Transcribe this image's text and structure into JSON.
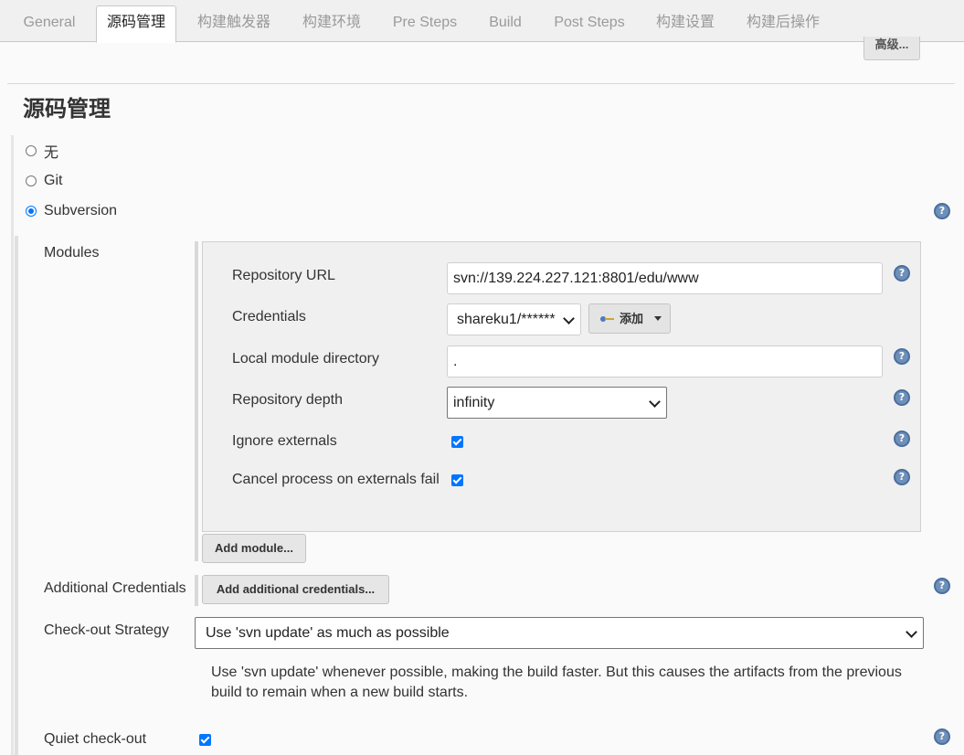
{
  "tabs": [
    {
      "label": "General"
    },
    {
      "label": "源码管理"
    },
    {
      "label": "构建触发器"
    },
    {
      "label": "构建环境"
    },
    {
      "label": "Pre Steps"
    },
    {
      "label": "Build"
    },
    {
      "label": "Post Steps"
    },
    {
      "label": "构建设置"
    },
    {
      "label": "构建后操作"
    }
  ],
  "active_tab_index": 1,
  "advanced_button": "高级...",
  "section": {
    "title": "源码管理"
  },
  "scm_options": [
    {
      "label": "无",
      "selected": false
    },
    {
      "label": "Git",
      "selected": false
    },
    {
      "label": "Subversion",
      "selected": true
    }
  ],
  "modules": {
    "label": "Modules",
    "repository_url": {
      "label": "Repository URL",
      "value": "svn://139.224.227.121:8801/edu/www"
    },
    "credentials": {
      "label": "Credentials",
      "value": "shareku1/******",
      "add_label": "添加"
    },
    "local_module_directory": {
      "label": "Local module directory",
      "value": "."
    },
    "repository_depth": {
      "label": "Repository depth",
      "value": "infinity"
    },
    "ignore_externals": {
      "label": "Ignore externals",
      "checked": true
    },
    "cancel_on_externals_fail": {
      "label": "Cancel process on externals fail",
      "checked": true
    },
    "add_module_button": "Add module..."
  },
  "additional_credentials": {
    "label": "Additional Credentials",
    "button": "Add additional credentials..."
  },
  "checkout_strategy": {
    "label": "Check-out Strategy",
    "value": "Use 'svn update' as much as possible",
    "description": "Use 'svn update' whenever possible, making the build faster. But this causes the artifacts from the previous build to remain when a new build starts."
  },
  "quiet_checkout": {
    "label": "Quiet check-out",
    "checked": true
  },
  "colors": {
    "accent": "#0075ff",
    "help": "#6e8fb8"
  }
}
